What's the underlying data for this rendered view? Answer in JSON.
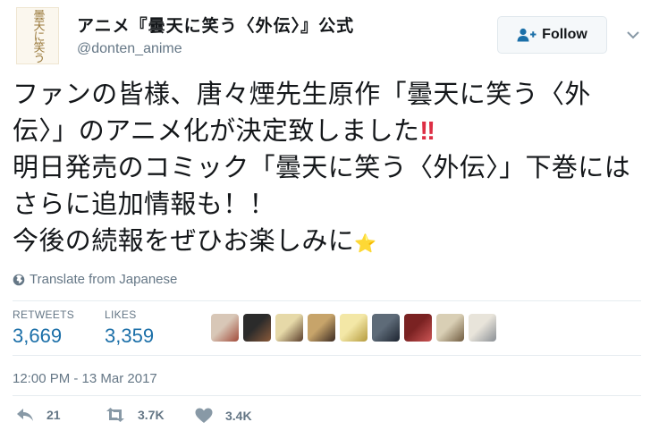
{
  "profile": {
    "display_name": "アニメ『曇天に笑う〈外伝〉』公式",
    "handle": "@donten_anime",
    "avatar_logo_text": "曇天に笑う"
  },
  "follow_label": "Follow",
  "tweet": {
    "lines": [
      "ファンの皆様、唐々煙先生原作「曇天に笑う〈外",
      "伝〉」のアニメ化が決定致しました",
      "明日発売のコミック「曇天に笑う〈外伝〉」下巻には",
      "さらに追加情報も！！",
      "今後の続報をぜひお楽しみに"
    ],
    "emoji_bangs": "‼",
    "emoji_star": "⭐"
  },
  "translate_label": "Translate from Japanese",
  "stats": {
    "retweets_label": "RETWEETS",
    "retweets_value": "3,669",
    "likes_label": "LIKES",
    "likes_value": "3,359"
  },
  "likers": [
    {
      "name": "liker-1",
      "colors": [
        "#d8c7b7",
        "#a24b3a"
      ]
    },
    {
      "name": "liker-2",
      "colors": [
        "#2b2b2b",
        "#8a5a3a"
      ]
    },
    {
      "name": "liker-3",
      "colors": [
        "#e6d9a8",
        "#5a3d2a"
      ]
    },
    {
      "name": "liker-4",
      "colors": [
        "#c7a46a",
        "#3b2a22"
      ]
    },
    {
      "name": "liker-5",
      "colors": [
        "#f3e7a6",
        "#b59b3d"
      ]
    },
    {
      "name": "liker-6",
      "colors": [
        "#5e6b78",
        "#1d2430"
      ]
    },
    {
      "name": "liker-7",
      "colors": [
        "#7a2222",
        "#c55"
      ]
    },
    {
      "name": "liker-8",
      "colors": [
        "#d9cfb5",
        "#6f5a3e"
      ]
    },
    {
      "name": "liker-9",
      "colors": [
        "#e8e4da",
        "#8a8f95"
      ]
    }
  ],
  "timestamp": "12:00 PM - 13 Mar 2017",
  "actions": {
    "reply_count": "21",
    "retweet_count": "3.7K",
    "like_count": "3.4K"
  },
  "colors": {
    "accent": "#1b6fa8",
    "muted": "#657786",
    "emoji_red": "#dd2e44"
  }
}
